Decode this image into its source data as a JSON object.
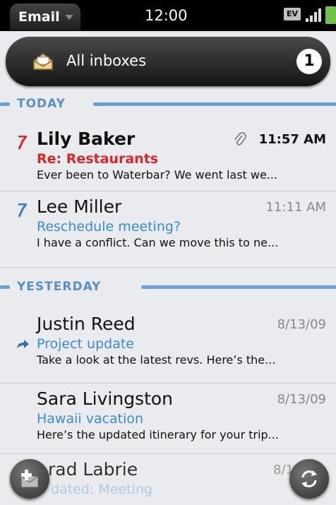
{
  "status_bar": {
    "app_menu": "Email",
    "time": "12:00",
    "network_badge": "EV"
  },
  "header": {
    "title": "All inboxes",
    "unread_count": "1"
  },
  "groups": [
    {
      "label": "TODAY"
    },
    {
      "label": "YESTERDAY"
    }
  ],
  "emails": [
    {
      "sender": "Lily Baker",
      "time": "11:57 AM",
      "subject": "Re: Restaurants",
      "preview": "Ever been to Waterbar? We went last we...",
      "unread": true,
      "flag": "red",
      "attachment": true
    },
    {
      "sender": "Lee Miller",
      "time": "11:11 AM",
      "subject": "Reschedule meeting?",
      "preview": "I have a conflict. Can we move this to ne...",
      "unread": false,
      "flag": "blue"
    },
    {
      "sender": "Justin Reed",
      "time": "8/13/09",
      "subject": "Project update",
      "preview": "Take a look at the latest revs. Here’s the...",
      "unread": false,
      "forwarded": true
    },
    {
      "sender": "Sara Livingston",
      "time": "8/13/09",
      "subject": "Hawaii vacation",
      "preview": "Here’s the updated itinerary for your trip...",
      "unread": false
    },
    {
      "sender": "rad Labrie",
      "time": "8/1",
      "subject": "dated: Meeting",
      "preview": "",
      "unread": false
    }
  ],
  "colors": {
    "accent_blue": "#3a8ad6",
    "unread_red": "#d8262a",
    "divider_blue": "#6b9fd6",
    "list_bg": "#e9ebee"
  },
  "icons": {
    "compose": "compose-icon",
    "sync": "sync-icon",
    "inbox": "inbox-icon",
    "attachment": "paperclip-icon",
    "flag": "flag-icon",
    "forward": "forward-arrow-icon"
  }
}
